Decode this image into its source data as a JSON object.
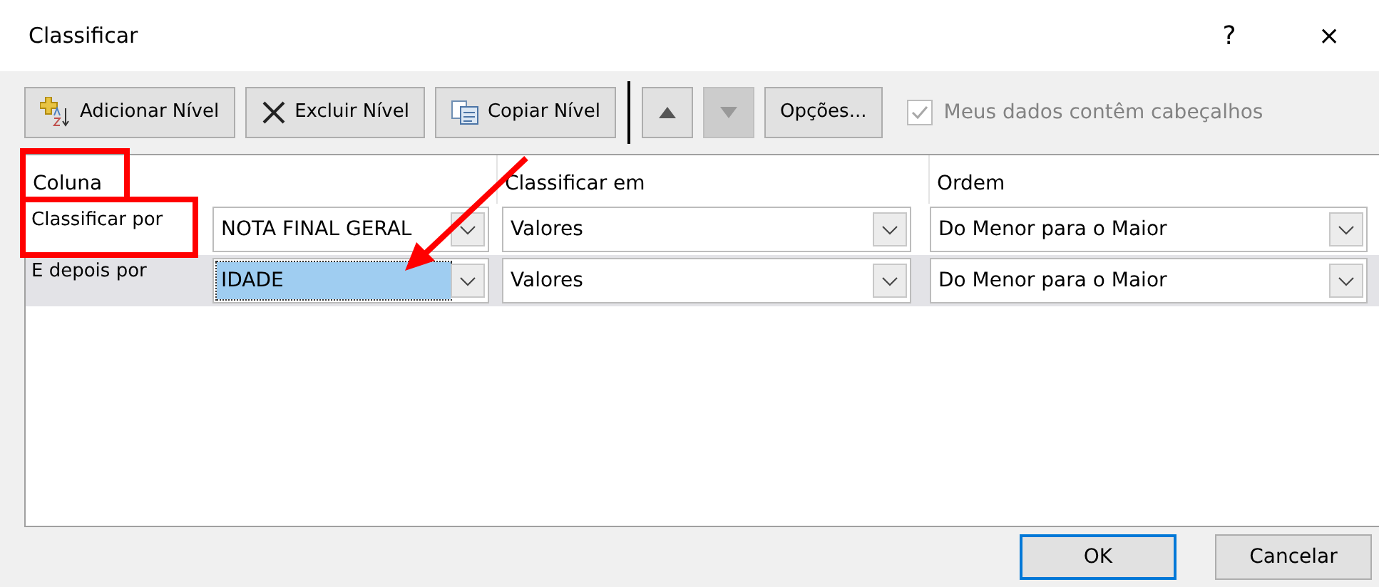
{
  "window": {
    "title": "Classificar",
    "help": "?",
    "close": "×"
  },
  "toolbar": [
    {
      "kind": "add",
      "label": "Adicionar Nível",
      "disabled": false
    },
    {
      "kind": "delete",
      "label": "Excluir Nível",
      "disabled": false
    },
    {
      "kind": "copy",
      "label": "Copiar Nível",
      "disabled": false
    },
    {
      "kind": "up",
      "disabled": false
    },
    {
      "kind": "down",
      "disabled": true
    },
    {
      "kind": "options",
      "label": "Opções...",
      "disabled": false
    }
  ],
  "header_checkbox": {
    "label": "Meus dados contêm cabeçalhos",
    "checked": true,
    "disabled": true
  },
  "columns": [
    "Coluna",
    "Classificar em",
    "Ordem"
  ],
  "rows": [
    {
      "label": "Classificar por",
      "column": "NOTA FINAL GERAL",
      "sort_on": "Valores",
      "order": "Do Menor para o Maior",
      "selected": false
    },
    {
      "label": "E depois por",
      "column": "IDADE",
      "sort_on": "Valores",
      "order": "Do Menor para o Maior",
      "selected": true
    }
  ],
  "buttons": [
    {
      "label": "OK",
      "default": true
    },
    {
      "label": "Cancelar",
      "default": false
    }
  ]
}
